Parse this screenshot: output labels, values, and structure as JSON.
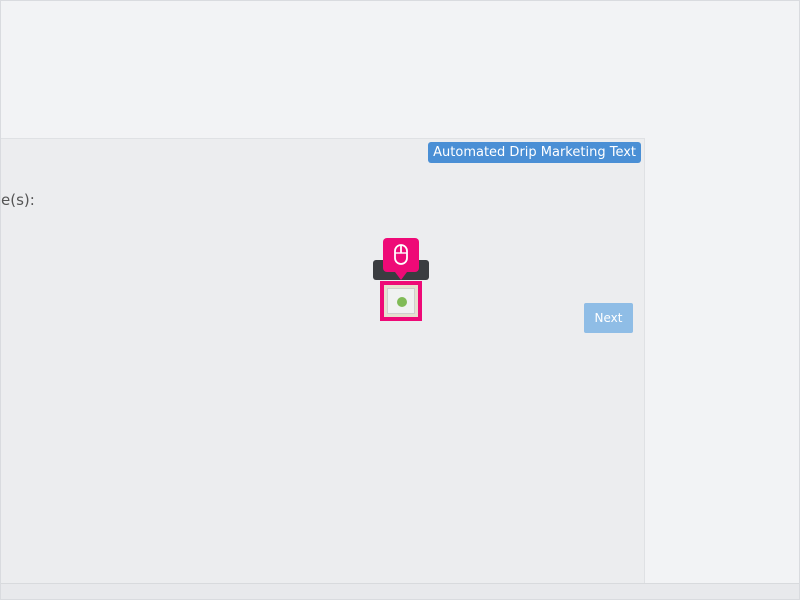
{
  "panel": {
    "tag_label": "Automated Drip Marketing Text",
    "field_label_fragment": "e(s):",
    "next_label": "Next"
  },
  "icons": {
    "click_marker": "mouse-icon",
    "hotspot_dot": "green-dot-icon"
  },
  "colors": {
    "accent": "#4a8fd5",
    "highlight": "#ee0a77",
    "status_dot": "#80bb56",
    "button_disabled": "#8fbde6"
  }
}
